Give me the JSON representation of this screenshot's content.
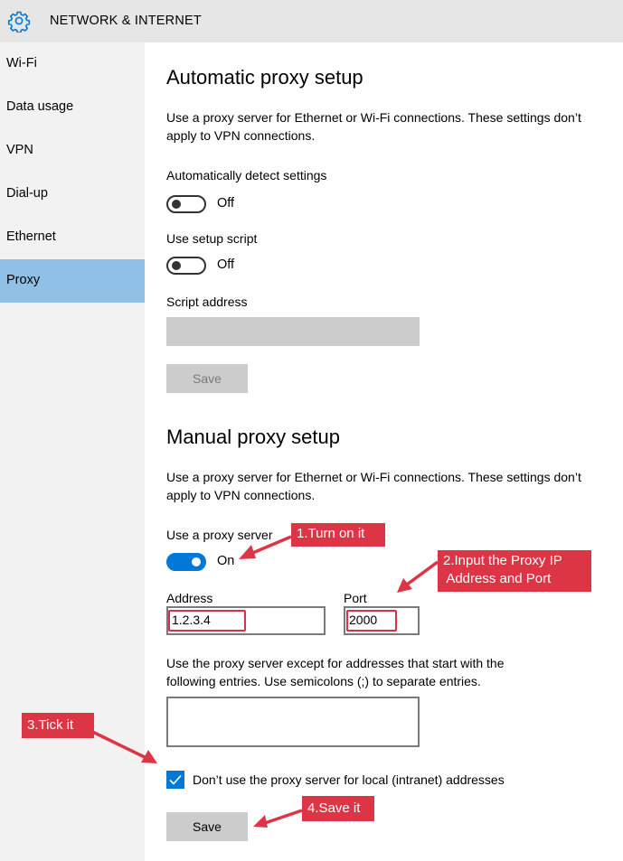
{
  "header": {
    "title": "NETWORK & INTERNET",
    "icon": "gear-icon"
  },
  "sidebar": {
    "items": [
      {
        "label": "Wi-Fi",
        "active": false
      },
      {
        "label": "Data usage",
        "active": false
      },
      {
        "label": "VPN",
        "active": false
      },
      {
        "label": "Dial-up",
        "active": false
      },
      {
        "label": "Ethernet",
        "active": false
      },
      {
        "label": "Proxy",
        "active": true
      }
    ]
  },
  "automatic": {
    "heading": "Automatic proxy setup",
    "description": "Use a proxy server for Ethernet or Wi-Fi connections. These settings don’t apply to VPN connections.",
    "detect_label": "Automatically detect settings",
    "detect_state": "Off",
    "script_label": "Use setup script",
    "script_state": "Off",
    "script_address_label": "Script address",
    "script_address_value": "",
    "save_label": "Save"
  },
  "manual": {
    "heading": "Manual proxy setup",
    "description": "Use a proxy server for Ethernet or Wi-Fi connections. These settings don’t apply to VPN connections.",
    "use_proxy_label": "Use a proxy server",
    "use_proxy_state": "On",
    "address_label": "Address",
    "address_value": "1.2.3.4",
    "port_label": "Port",
    "port_value": "2000",
    "exceptions_description": "Use the proxy server except for addresses that start with the following entries. Use semicolons (;) to separate entries.",
    "exceptions_value": "",
    "local_bypass_label": "Don’t use the proxy server for local (intranet) addresses",
    "local_bypass_checked": true,
    "save_label": "Save"
  },
  "annotations": {
    "step1": "1.Turn on it",
    "step2_line1": "2.Input the Proxy IP",
    "step2_line2": " Address and Port",
    "step3": "3.Tick it",
    "step4": "4.Save it",
    "color": "#dc3545"
  },
  "colors": {
    "accent": "#0078d7",
    "sidebar_active": "#90c0e6",
    "header_bg": "#e6e6e6",
    "sidebar_bg": "#f2f2f2"
  }
}
